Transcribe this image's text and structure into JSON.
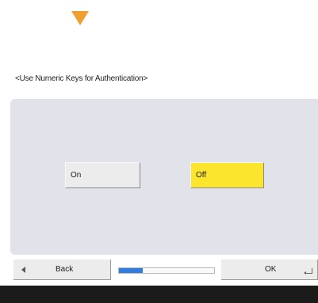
{
  "colors": {
    "arrow": "#f0a030",
    "selected_option": "#fbe52d",
    "panel_background": "#e2e3ea",
    "progress_fill": "#2f7de1",
    "bottom_strip": "#1b1b1b"
  },
  "header": {
    "setting_title": "<Use Numeric Keys for Authentication>"
  },
  "options": {
    "on_label": "On",
    "off_label": "Off",
    "selected": "Off"
  },
  "footer": {
    "back_label": "Back",
    "ok_label": "OK",
    "progress_fraction": 0.25
  },
  "icons": {
    "arrow": "down-arrow-icon",
    "back": "chevron-left-icon",
    "ok": "enter-icon"
  }
}
